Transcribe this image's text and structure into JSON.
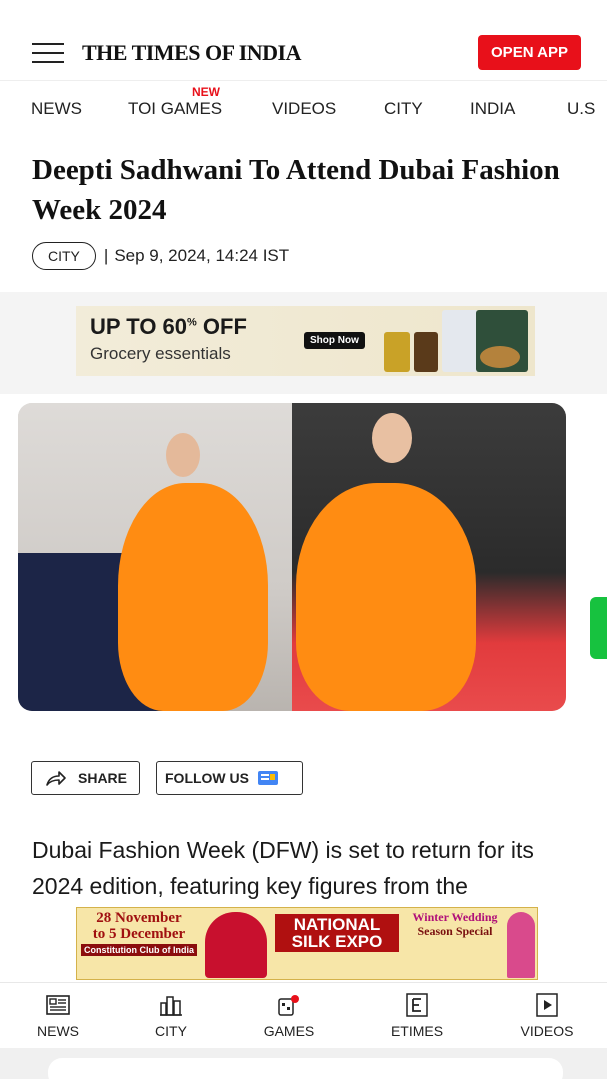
{
  "header": {
    "logo": "THE TIMES OF INDIA",
    "open_app": "OPEN APP"
  },
  "nav": {
    "items": [
      "NEWS",
      "TOI GAMES",
      "VIDEOS",
      "CITY",
      "INDIA",
      "U.S"
    ],
    "new_badge": "NEW"
  },
  "article": {
    "title": "Deepti Sadhwani To Attend Dubai Fashion Week 2024",
    "tag": "CITY",
    "separator": "|",
    "date": "Sep 9, 2024, 14:24 IST",
    "share_label": "SHARE",
    "follow_label": "FOLLOW US",
    "body": "Dubai Fashion Week (DFW) is set to return for its 2024 edition, featuring key figures from the"
  },
  "ad_top": {
    "headline_prefix": "UP TO 60",
    "headline_pct": "%",
    "headline_suffix": " OFF",
    "subline": "Grocery essentials",
    "button": "Shop Now"
  },
  "ad_bottom": {
    "dates_line1": "28 November",
    "dates_line2": "to 5 December",
    "venue": "Constitution Club of India",
    "brand_line1": "NATIONAL",
    "brand_line2": "SILK EXPO",
    "promo_line1": "Winter Wedding",
    "promo_line2": "Season Special"
  },
  "bottom_nav": {
    "items": [
      {
        "label": "NEWS",
        "icon": "newspaper-icon"
      },
      {
        "label": "CITY",
        "icon": "city-icon"
      },
      {
        "label": "GAMES",
        "icon": "games-icon"
      },
      {
        "label": "ETIMES",
        "icon": "etimes-icon"
      },
      {
        "label": "VIDEOS",
        "icon": "play-icon"
      }
    ]
  },
  "colors": {
    "brand_red": "#e8101a",
    "accent_green": "#17c23f",
    "dress_orange": "#ff8c12"
  }
}
